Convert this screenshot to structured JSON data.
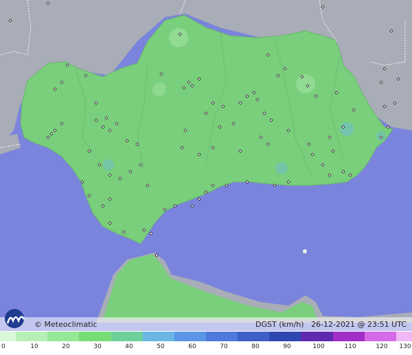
{
  "credit": "© Meteoclimatic",
  "product": "DGST (km/h)",
  "timestamp": "26-12-2021 @ 23:51 UTC",
  "scale": {
    "ticks": [
      "0",
      "10",
      "20",
      "30",
      "40",
      "50",
      "60",
      "70",
      "80",
      "90",
      "100",
      "110",
      "120",
      "130"
    ],
    "colors": [
      "#d9f7d9",
      "#b7f0b7",
      "#95e895",
      "#77dd77",
      "#6fcf9c",
      "#6ab7e6",
      "#5b97e6",
      "#4f79dc",
      "#3f5fc8",
      "#2f47b0",
      "#5e2bb0",
      "#a02fc6",
      "#d46ae6",
      "#f0b8f4"
    ]
  },
  "colors": {
    "sea": "#7a84dc",
    "land": "#79cf7c",
    "neighbor": "#a9adb7"
  }
}
